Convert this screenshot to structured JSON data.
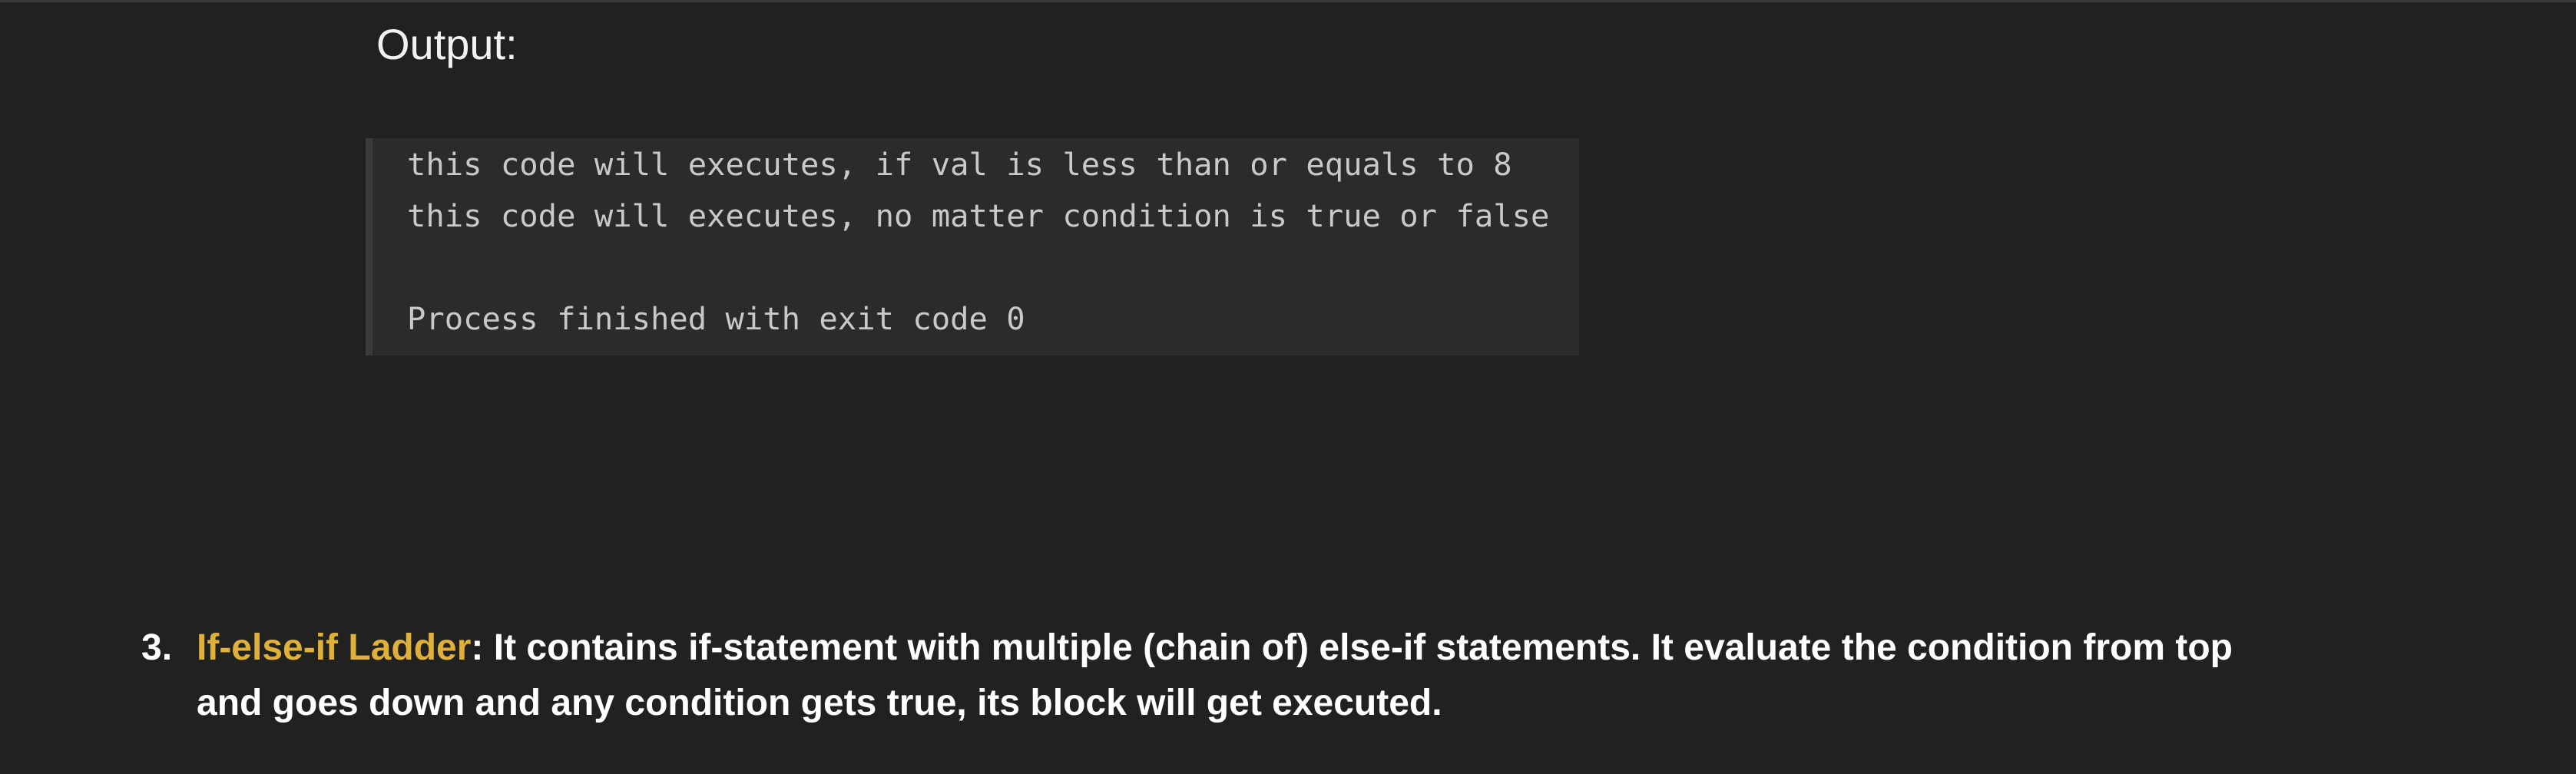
{
  "output_heading": "Output:",
  "console": {
    "lines": [
      "this code will executes, if val is less than or equals to 8",
      "this code will executes, no matter condition is true or false",
      "Process finished with exit code 0"
    ]
  },
  "list_item": {
    "number": "3.",
    "term": "If-else-if Ladder",
    "colon": ":",
    "line_1_rest": " It contains if-statement with multiple (chain of) else-if statements. It evaluate the condition from top",
    "line_2": "and goes down and any condition gets true, its block will get executed.",
    "term_color": "#e0b13a"
  },
  "colors": {
    "background": "#212120",
    "console_background": "#2b2b2b",
    "console_text": "#c9c9c9"
  }
}
